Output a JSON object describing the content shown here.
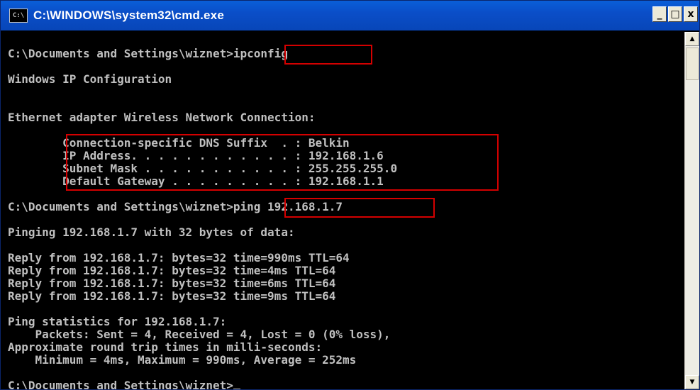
{
  "window": {
    "title": "C:\\WINDOWS\\system32\\cmd.exe",
    "icon_label": "C:\\",
    "buttons": {
      "minimize": "_",
      "maximize": "□",
      "close": "x"
    }
  },
  "console": {
    "lines": [
      "C:\\Documents and Settings\\wiznet>ipconfig",
      "Windows IP Configuration",
      "Ethernet adapter Wireless Network Connection:",
      "        Connection-specific DNS Suffix  . : Belkin",
      "        IP Address. . . . . . . . . . . . : 192.168.1.6",
      "        Subnet Mask . . . . . . . . . . . : 255.255.255.0",
      "        Default Gateway . . . . . . . . . : 192.168.1.1",
      "C:\\Documents and Settings\\wiznet>ping 192.168.1.7",
      "Pinging 192.168.1.7 with 32 bytes of data:",
      "Reply from 192.168.1.7: bytes=32 time=990ms TTL=64",
      "Reply from 192.168.1.7: bytes=32 time=4ms TTL=64",
      "Reply from 192.168.1.7: bytes=32 time=6ms TTL=64",
      "Reply from 192.168.1.7: bytes=32 time=9ms TTL=64",
      "Ping statistics for 192.168.1.7:",
      "    Packets: Sent = 4, Received = 4, Lost = 0 (0% loss),",
      "Approximate round trip times in milli-seconds:",
      "    Minimum = 4ms, Maximum = 990ms, Average = 252ms",
      "C:\\Documents and Settings\\wiznet>"
    ]
  },
  "colors": {
    "console_bg": "#000000",
    "console_fg": "#c0c0c0",
    "highlight": "#d40000",
    "titlebar": "#0a4ec8"
  },
  "icons": {
    "title_icon": "cmd-icon",
    "scroll_up": "arrow-up-icon",
    "scroll_down": "arrow-down-icon"
  }
}
